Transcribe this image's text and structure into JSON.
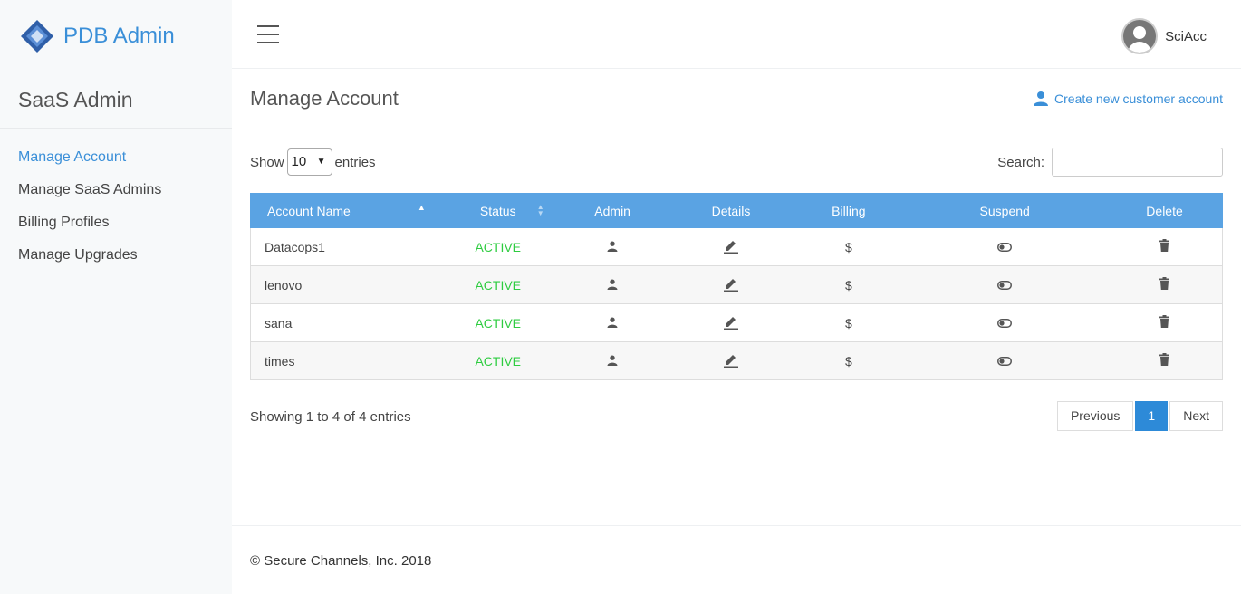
{
  "brand": {
    "name": "PDB Admin"
  },
  "sidebar": {
    "title": "SaaS Admin",
    "items": [
      {
        "label": "Manage Account",
        "active": true
      },
      {
        "label": "Manage SaaS Admins"
      },
      {
        "label": "Billing Profiles"
      },
      {
        "label": "Manage Upgrades"
      }
    ]
  },
  "topbar": {
    "user_name": "SciAcc"
  },
  "page": {
    "title": "Manage Account",
    "create_link": "Create new customer account"
  },
  "controls": {
    "show_label": "Show",
    "entries_label": "entries",
    "page_size": "10",
    "search_label": "Search:",
    "search_value": ""
  },
  "table": {
    "columns": [
      "Account Name",
      "Status",
      "Admin",
      "Details",
      "Billing",
      "Suspend",
      "Delete"
    ],
    "rows": [
      {
        "name": "Datacops1",
        "status": "ACTIVE",
        "billing": "$"
      },
      {
        "name": "lenovo",
        "status": "ACTIVE",
        "billing": "$"
      },
      {
        "name": "sana",
        "status": "ACTIVE",
        "billing": "$"
      },
      {
        "name": "times",
        "status": "ACTIVE",
        "billing": "$"
      }
    ]
  },
  "pagination": {
    "info": "Showing 1 to 4 of 4 entries",
    "previous": "Previous",
    "current": "1",
    "next": "Next"
  },
  "footer": {
    "copyright": "© Secure Channels, Inc. 2018"
  },
  "colors": {
    "accent": "#3a8fd8",
    "header_bg": "#5aa3e3",
    "status_active": "#2ecc40"
  }
}
